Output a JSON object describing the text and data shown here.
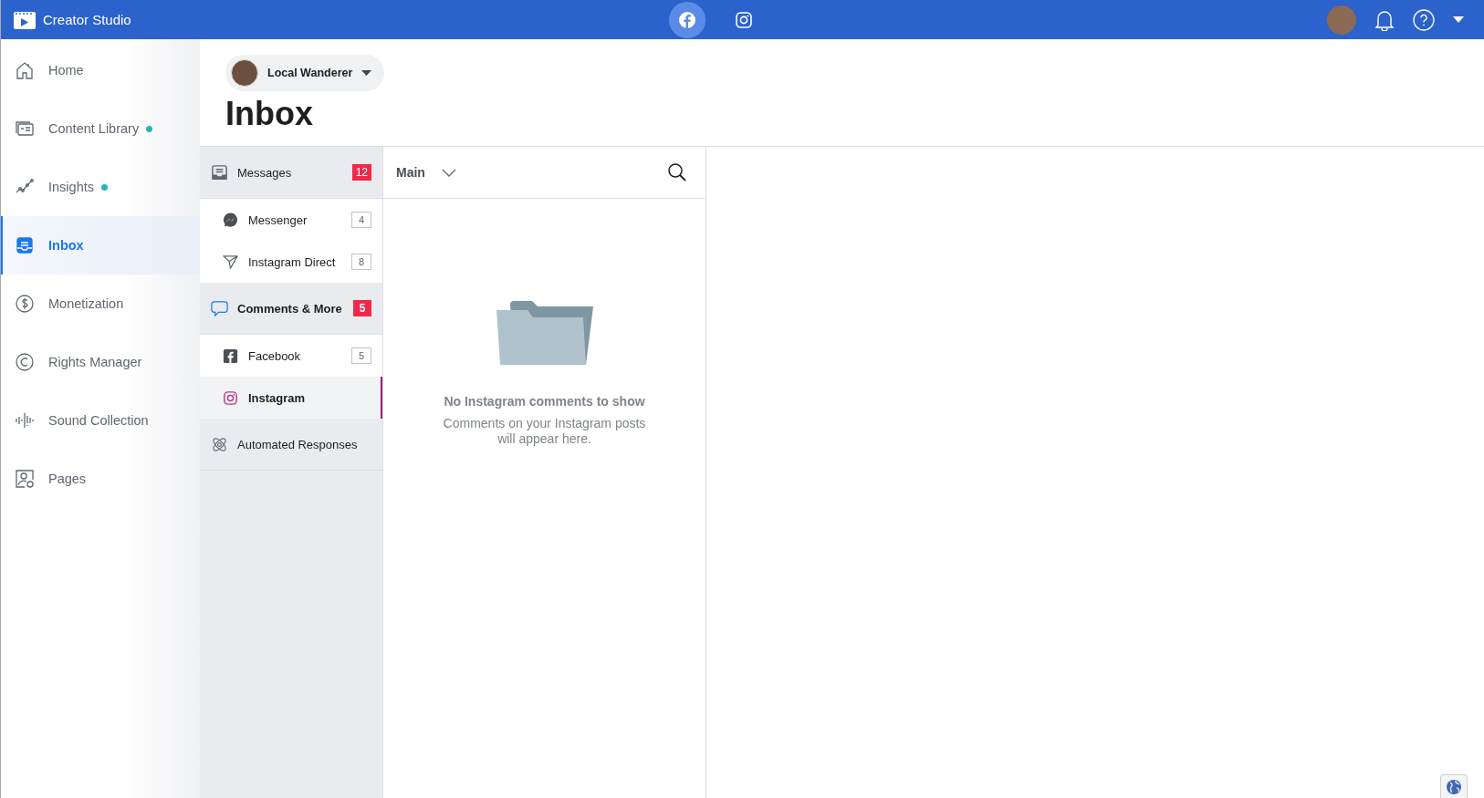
{
  "app": {
    "title": "Creator Studio"
  },
  "platform_tabs": [
    {
      "selected": true
    },
    {
      "selected": false
    }
  ],
  "sidebar": {
    "items": [
      {
        "label": "Home",
        "selected": false,
        "dot": false
      },
      {
        "label": "Content Library",
        "selected": false,
        "dot": true
      },
      {
        "label": "Insights",
        "selected": false,
        "dot": true
      },
      {
        "label": "Inbox",
        "selected": true,
        "dot": false
      },
      {
        "label": "Monetization",
        "selected": false,
        "dot": false
      },
      {
        "label": "Rights Manager",
        "selected": false,
        "dot": false
      },
      {
        "label": "Sound Collection",
        "selected": false,
        "dot": false
      },
      {
        "label": "Pages",
        "selected": false,
        "dot": false
      }
    ]
  },
  "page_selector": {
    "name": "Local Wanderer"
  },
  "page_title": "Inbox",
  "inbox_nav": [
    {
      "kind": "group",
      "label": "Messages",
      "count": "12",
      "selected": false
    },
    {
      "kind": "source",
      "label": "Messenger",
      "count": "4",
      "selected": false
    },
    {
      "kind": "source",
      "label": "Instagram Direct",
      "count": "8",
      "selected": false
    },
    {
      "kind": "group",
      "label": "Comments & More",
      "count": "5",
      "selected": true
    },
    {
      "kind": "source",
      "label": "Facebook",
      "count": "5",
      "selected": false
    },
    {
      "kind": "source",
      "label": "Instagram",
      "selected": true
    },
    {
      "kind": "group",
      "label": "Automated Responses",
      "selected": false
    }
  ],
  "list_panel": {
    "filter": "Main",
    "empty_title": "No Instagram comments to show",
    "empty_text": "Comments on your Instagram posts will appear here."
  }
}
